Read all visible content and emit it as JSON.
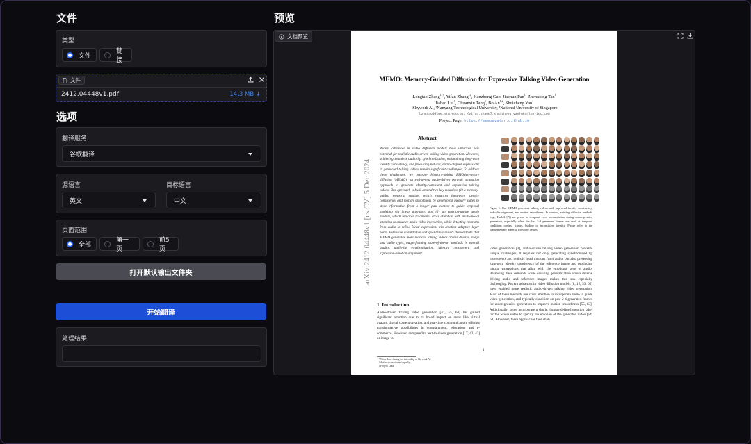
{
  "left": {
    "file_title": "文件",
    "type_label": "类型",
    "type_options": [
      "文件",
      "链接"
    ],
    "type_selected": "文件",
    "file_chip": "文件",
    "file_name": "2412.04448v1.pdf",
    "file_size": "14.3 MB ↓",
    "options_title": "选项",
    "service_label": "翻译服务",
    "service_value": "谷歌翻译",
    "source_label": "源语言",
    "source_value": "英文",
    "target_label": "目标语言",
    "target_value": "中文",
    "range_label": "页面范围",
    "range_options": [
      "全部",
      "第一页",
      "前5页"
    ],
    "range_selected": "全部",
    "open_folder_button": "打开默认输出文件夹",
    "start_button": "开始翻译",
    "result_label": "处理结果",
    "result_value": ""
  },
  "right": {
    "title": "预览",
    "chip": "文档预览"
  },
  "paper": {
    "title": "MEMO: Memory-Guided Diffusion for Expressive Talking Video Generation",
    "authors_1": "Longtao Zheng",
    "authors_1_sup": "1*†",
    "authors_1_rest": ", Yifan Zhang",
    "authors_1_rest_sup": "1‡",
    "authors_1_tail": ", Hanzhong Guo, Jiachun Pan",
    "authors_1_tail_sup": "1",
    "authors_1_end": ", Zhenxiong Tan",
    "authors_1_end_sup": "1",
    "authors_2": "Jiahao Lu",
    "authors_2_sup": "1†",
    "authors_2_rest": ", Chuanxin Tang",
    "authors_2_rest_sup": "1",
    "authors_2_tail": ", Bo An",
    "authors_2_tail_sup": "1,2",
    "authors_2_end": ", Shuicheng Yan",
    "authors_2_end_sup": "1",
    "affiliations": "¹Skywork AI, ²Nanyang Technological University, ³National University of Singapore",
    "emails": "longtao001@e.ntu.edu.sg, {yifan.zhang7,shuicheng.yan}@kunlun-inc.com",
    "project_prefix": "Project Page: ",
    "project_url": "https://memoavatar.github.io",
    "arxiv": "arXiv:2412.04448v1  [cs.CV]  5 Dec 2024",
    "abstract_heading": "Abstract",
    "abstract_text": "Recent advances in video diffusion models have unlocked new potential for realistic audio-driven talking video generation. However, achieving seamless audio-lip synchronization, maintaining long-term identity consistency, and producing natural, audio-aligned expressions in generated talking videos remain significant challenges. To address these challenges, we propose Memory-guided EMOtion-aware diffusion (MEMO), an end-to-end audio-driven portrait animation approach to generate identity-consistent and expressive talking videos. Our approach is built around two key modules: (1) a memory-guided temporal module, which enhances long-term identity consistency and motion smoothness by developing memory states to store information from a longer past context to guide temporal modeling via linear attention; and (2) an emotion-aware audio module, which replaces traditional cross attention with multi-modal attention to enhance audio-video interaction, while detecting emotions from audio to refine facial expressions via emotion adaptive layer norm. Extensive quantitative and qualitative results demonstrate that MEMO generates more realistic talking videos across diverse image and audio types, outperforming state-of-the-art methods in overall quality, audio-lip synchronization, identity consistency, and expression-emotion alignment.",
    "intro_heading": "1. Introduction",
    "intro_text": "Audio-driven talking video generation [41, 55, 64] has gained significant attention due to its broad impact on areas like virtual avatars, digital content creation, and real-time communication, offering transformative possibilities in entertainment, education, and e-commerce. However, compared to text-to-video generation [17, 42, 43] or image-to-",
    "footnotes": [
      "*Work done during the internship at Skywork AI.",
      "†Authors contributed equally",
      "‡Project Lead."
    ],
    "figure_caption": "Figure 1. Our MEMO generates talking videos with improved identity consistency, audio-lip alignment, and motion smoothness. In contrast, existing diffusion methods (e.g., Hallo2 [7]) are prone to temporal error accumulation during autoregressive generation, especially when the last 2-4 generated frames are used as temporal conditions context frames, leading to inconsistent identity. Please refer to the supplementary material for video demos.",
    "right_col_text": "video generation [3], audio-driven talking video generation presents unique challenges. It requires not only generating synchronized lip movements and realistic head motions from audio, but also preserving long-term identity consistency of the reference image and producing natural expressions that align with the emotional tone of audio. Balancing these demands while ensuring generalization across diverse driving audio and reference images makes this task especially challenging. Recent advances in video diffusion models [8, 12, 53, 65] have enabled more realistic audio-driven talking video generation. Most of these methods use cross attention to incorporate audio to guide video generation, and typically condition on past 2-4 generated frames for autoregressive generation to improve motion smoothness [55, 63]. Additionally, some incorporate a single, human-defined emotion label for the whole video to specify the emotion of the generated video [54, 64]. However, these approaches face chal-",
    "page_number": "1"
  },
  "colors": {
    "accent": "#2f6bff",
    "panel": "#1c1c20",
    "start_button": "#1d4ed8",
    "secondary_button": "#3f3f46"
  }
}
